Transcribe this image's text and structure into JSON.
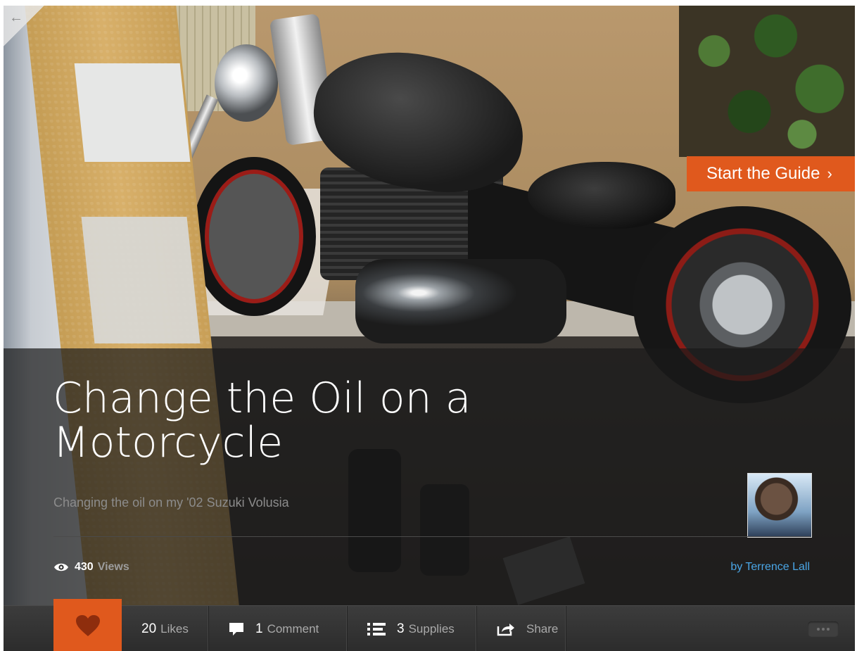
{
  "nav": {
    "back_icon": "←",
    "back_icon_name": "back-arrow-icon"
  },
  "guide": {
    "title": "Change the Oil on a Motorcycle",
    "subtitle": "Changing the oil on my '02 Suzuki Volusia",
    "start_button_label": "Start the Guide",
    "start_button_chevron": "›",
    "views_count": "430",
    "views_label": "Views",
    "author_label": "by Terrence Lall"
  },
  "toolbar": {
    "likes_count": "20",
    "likes_label": "Likes",
    "comments_count": "1",
    "comments_label": "Comment",
    "supplies_count": "3",
    "supplies_label": "Supplies",
    "share_label": "Share"
  },
  "colors": {
    "accent": "#e0591d",
    "link": "#4aa6e6",
    "overlay": "#191919"
  },
  "icons": [
    "back-arrow-icon",
    "eye-icon",
    "heart-icon",
    "comment-icon",
    "list-icon",
    "share-icon",
    "more-dots-icon"
  ]
}
